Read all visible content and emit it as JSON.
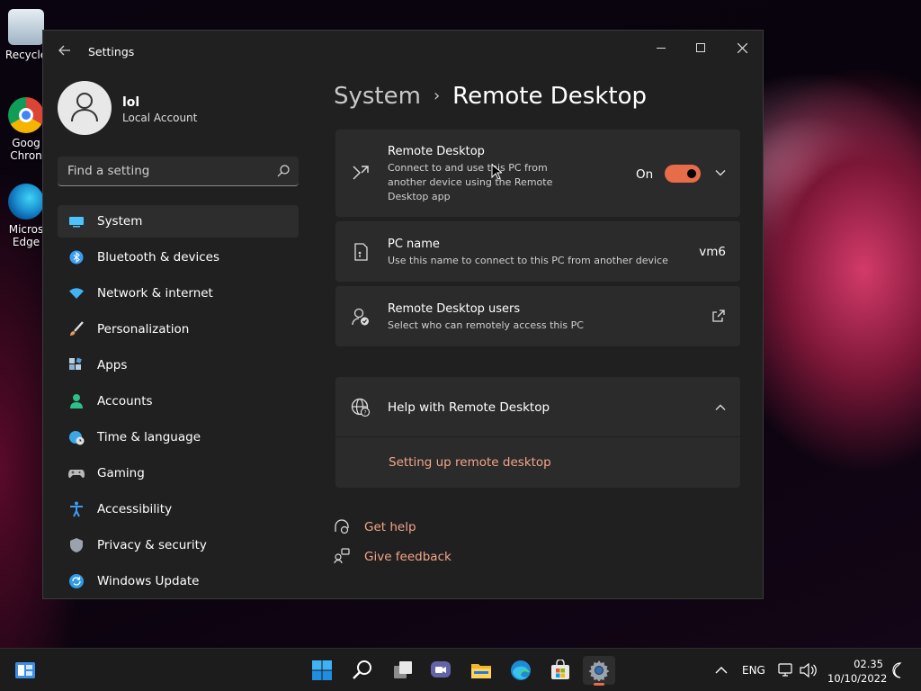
{
  "desktop": {
    "icons": [
      {
        "label": "Recycle",
        "icon": "recycle-bin-icon"
      },
      {
        "label": "Goog\nChron",
        "icon": "chrome-icon"
      },
      {
        "label": "Micros\nEdge",
        "icon": "edge-icon"
      }
    ]
  },
  "window": {
    "title": "Settings",
    "profile": {
      "name": "lol",
      "account_type": "Local Account"
    },
    "search": {
      "placeholder": "Find a setting"
    },
    "nav": [
      {
        "label": "System",
        "icon": "system-icon",
        "active": true,
        "color": "#4cc2ff"
      },
      {
        "label": "Bluetooth & devices",
        "icon": "bluetooth-icon",
        "color": "#3a9cf4"
      },
      {
        "label": "Network & internet",
        "icon": "wifi-icon",
        "color": "#43b2f2"
      },
      {
        "label": "Personalization",
        "icon": "brush-icon",
        "color": "#e29a5c"
      },
      {
        "label": "Apps",
        "icon": "apps-icon",
        "color": "#8fb2cf"
      },
      {
        "label": "Accounts",
        "icon": "accounts-icon",
        "color": "#2fbf8a"
      },
      {
        "label": "Time & language",
        "icon": "globe-clock-icon",
        "color": "#39a7e6"
      },
      {
        "label": "Gaming",
        "icon": "gamepad-icon",
        "color": "#b9b9b9"
      },
      {
        "label": "Accessibility",
        "icon": "accessibility-icon",
        "color": "#3d9bf0"
      },
      {
        "label": "Privacy & security",
        "icon": "shield-icon",
        "color": "#9aa3ad"
      },
      {
        "label": "Windows Update",
        "icon": "update-icon",
        "color": "#2e9be6"
      }
    ],
    "breadcrumb": {
      "parent": "System",
      "separator": "›",
      "current": "Remote Desktop"
    },
    "remote_desktop": {
      "title": "Remote Desktop",
      "description": "Connect to and use this PC from another device using the Remote Desktop app",
      "toggle_label": "On",
      "toggle_on": true
    },
    "pc_name": {
      "title": "PC name",
      "description": "Use this name to connect to this PC from another device",
      "value": "vm6"
    },
    "rd_users": {
      "title": "Remote Desktop users",
      "description": "Select who can remotely access this PC"
    },
    "help": {
      "title": "Help with Remote Desktop",
      "link": "Setting up remote desktop"
    },
    "footer": {
      "get_help": "Get help",
      "give_feedback": "Give feedback"
    }
  },
  "taskbar": {
    "apps": [
      "widgets-icon",
      "start-icon",
      "search-icon",
      "task-view-icon",
      "teams-chat-icon",
      "file-explorer-icon",
      "edge-icon",
      "store-icon",
      "settings-icon"
    ],
    "active_app": "settings-icon",
    "language": "ENG",
    "time": "02.35",
    "date": "10/10/2022"
  },
  "colors": {
    "accent": "#e66c4a",
    "link": "#f2a58a",
    "window_bg": "#202020",
    "card_bg": "#2b2b2b"
  }
}
